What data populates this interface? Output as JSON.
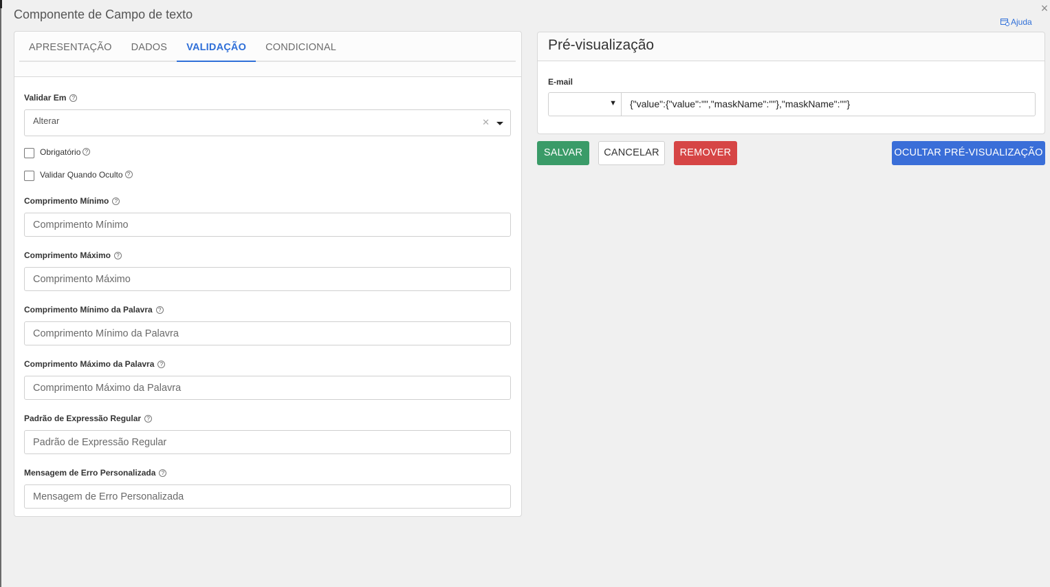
{
  "dialog": {
    "title": "Componente de Campo de texto",
    "close_symbol": "×",
    "help_label": "Ajuda",
    "help_icon": "external-help-icon"
  },
  "tabs": [
    {
      "label": "APRESENTAÇÃO",
      "active": false
    },
    {
      "label": "DADOS",
      "active": false
    },
    {
      "label": "VALIDAÇÃO",
      "active": true
    },
    {
      "label": "CONDICIONAL",
      "active": false
    }
  ],
  "validation": {
    "validate_on": {
      "label": "Validar Em",
      "value": "Alterar"
    },
    "required": {
      "label": "Obrigatório",
      "checked": false
    },
    "validate_when_hidden": {
      "label": "Validar Quando Oculto",
      "checked": false
    },
    "min_length": {
      "label": "Comprimento Mínimo",
      "placeholder": "Comprimento Mínimo"
    },
    "max_length": {
      "label": "Comprimento Máximo",
      "placeholder": "Comprimento Máximo"
    },
    "min_words": {
      "label": "Comprimento Mínimo da Palavra",
      "placeholder": "Comprimento Mínimo da Palavra"
    },
    "max_words": {
      "label": "Comprimento Máximo da Palavra",
      "placeholder": "Comprimento Máximo da Palavra"
    },
    "regex": {
      "label": "Padrão de Expressão Regular",
      "placeholder": "Padrão de Expressão Regular"
    },
    "custom_error": {
      "label": "Mensagem de Erro Personalizada",
      "placeholder": "Mensagem de Erro Personalizada"
    }
  },
  "preview": {
    "title": "Pré-visualização",
    "field_label": "E-mail",
    "value": "{\"value\":{\"value\":\"\",\"maskName\":\"\"},\"maskName\":\"\"}"
  },
  "buttons": {
    "save": "SALVAR",
    "cancel": "CANCELAR",
    "remove": "REMOVER",
    "hide_preview": "OCULTAR PRÉ-VISUALIZAÇÃO"
  },
  "colors": {
    "accent": "#2f6fd8",
    "save": "#3a9b68",
    "remove": "#d64545",
    "hide_preview": "#3a6ed8"
  }
}
